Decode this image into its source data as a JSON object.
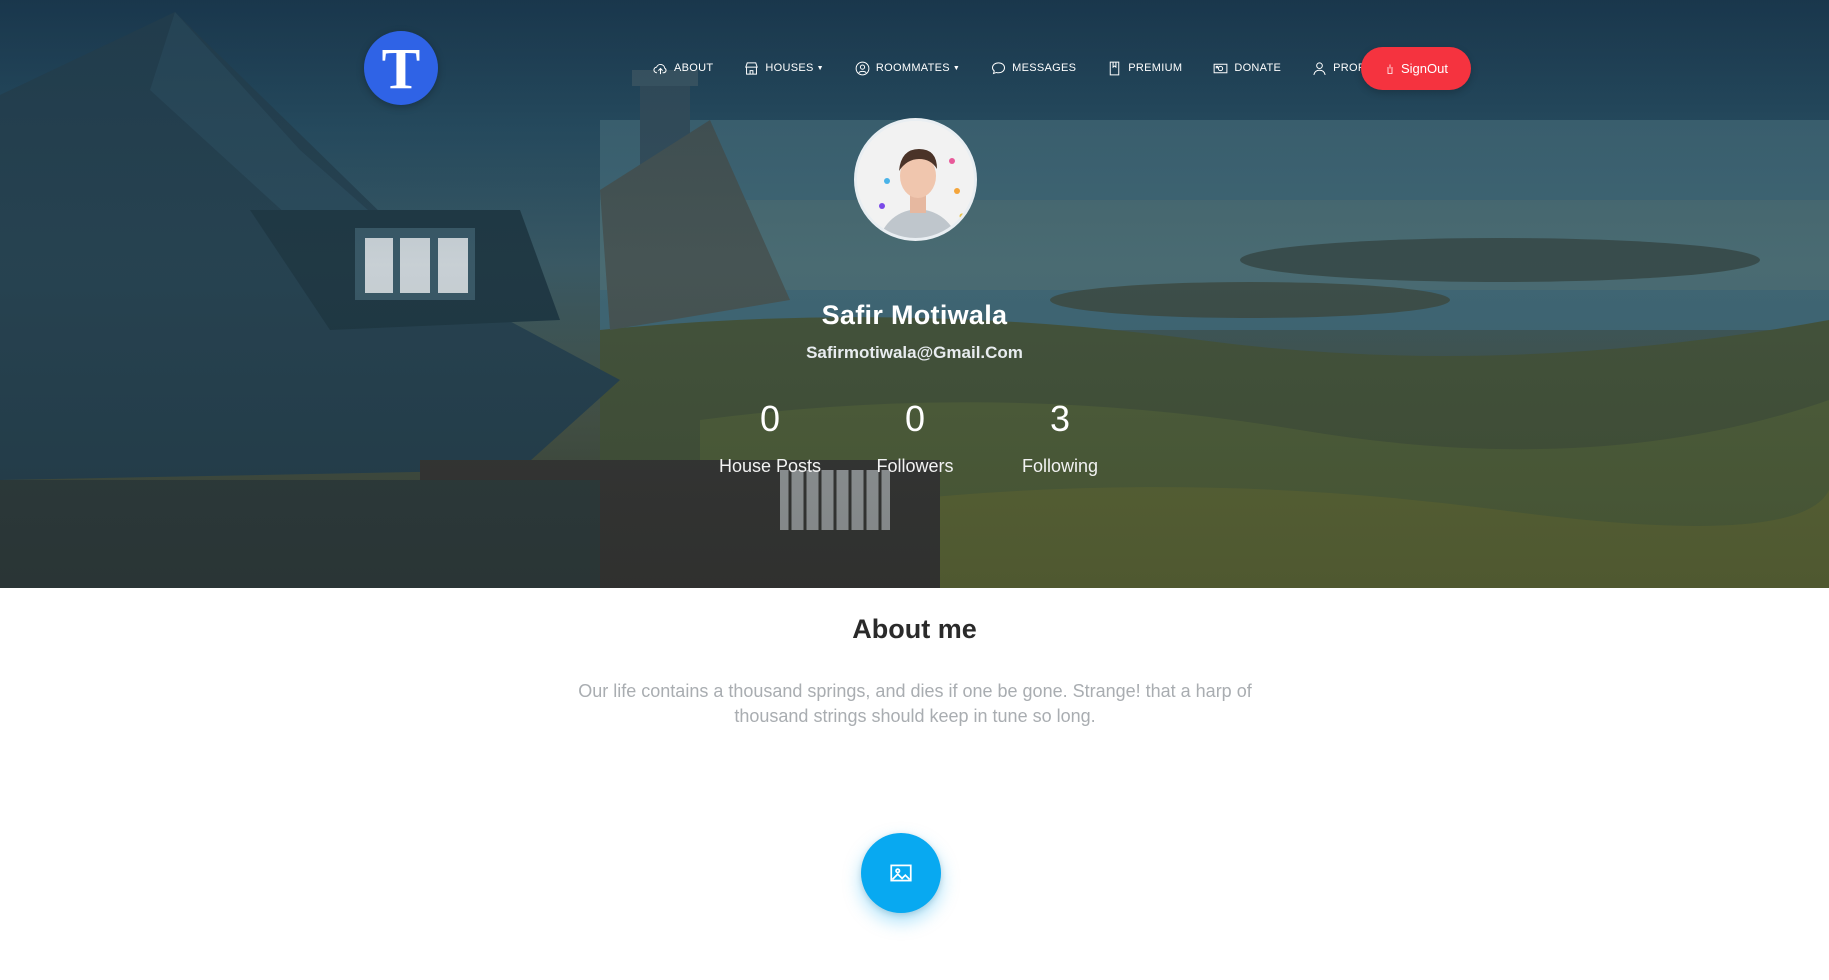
{
  "brand": {
    "logo_letter": "T",
    "color": "#2f63e6"
  },
  "nav": {
    "items": [
      {
        "label": "ABOUT",
        "icon": "cloud-upload-icon",
        "dropdown": false
      },
      {
        "label": "HOUSES",
        "icon": "house-icon",
        "dropdown": true
      },
      {
        "label": "ROOMMATES",
        "icon": "user-circle-icon",
        "dropdown": true
      },
      {
        "label": "MESSAGES",
        "icon": "chat-bubble-icon",
        "dropdown": false
      },
      {
        "label": "PREMIUM",
        "icon": "bookmark-icon",
        "dropdown": false
      },
      {
        "label": "DONATE",
        "icon": "money-icon",
        "dropdown": false
      },
      {
        "label": "PROFILE",
        "icon": "user-icon",
        "dropdown": false
      }
    ],
    "signout_label": "SignOut",
    "signout_icon": "power-icon",
    "signout_color": "#f5333f"
  },
  "profile": {
    "name": "Safir Motiwala",
    "email": "Safirmotiwala@Gmail.Com",
    "stats": [
      {
        "value": "0",
        "label": "House Posts"
      },
      {
        "value": "0",
        "label": "Followers"
      },
      {
        "value": "3",
        "label": "Following"
      }
    ]
  },
  "about": {
    "title": "About me",
    "text": "Our life contains a thousand springs, and dies if one be gone. Strange! that a harp of thousand strings should keep in tune so long."
  },
  "fab": {
    "icon": "image-icon",
    "color": "#08a9f1"
  }
}
